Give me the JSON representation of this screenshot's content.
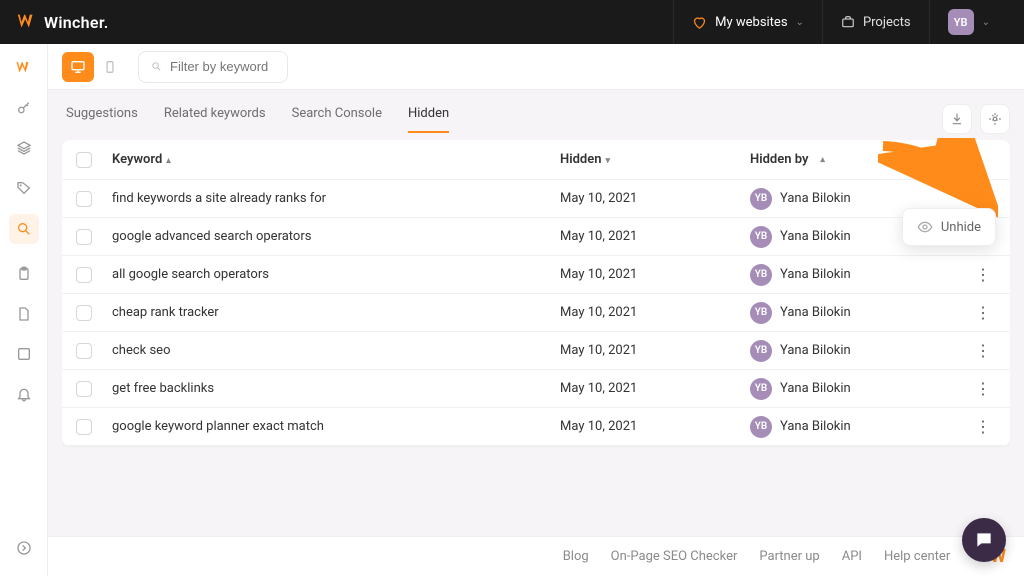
{
  "brand": "Wincher.",
  "nav": {
    "my_websites": "My websites",
    "projects": "Projects",
    "avatar_initials": "YB"
  },
  "filter": {
    "placeholder": "Filter by keyword"
  },
  "tabs": {
    "suggestions": "Suggestions",
    "related": "Related keywords",
    "console": "Search Console",
    "hidden": "Hidden"
  },
  "columns": {
    "keyword": "Keyword",
    "hidden": "Hidden",
    "hidden_by": "Hidden by"
  },
  "user": {
    "initials": "YB",
    "name": "Yana Bilokin"
  },
  "date": "May 10, 2021",
  "rows": [
    {
      "keyword": "find keywords a site already ranks for"
    },
    {
      "keyword": "google advanced search operators"
    },
    {
      "keyword": "all google search operators"
    },
    {
      "keyword": "cheap rank tracker"
    },
    {
      "keyword": "check seo"
    },
    {
      "keyword": "get free backlinks"
    },
    {
      "keyword": "google keyword planner exact match"
    }
  ],
  "popover": {
    "unhide": "Unhide"
  },
  "footer": {
    "blog": "Blog",
    "checker": "On-Page SEO Checker",
    "partner": "Partner up",
    "api": "API",
    "help": "Help center"
  }
}
